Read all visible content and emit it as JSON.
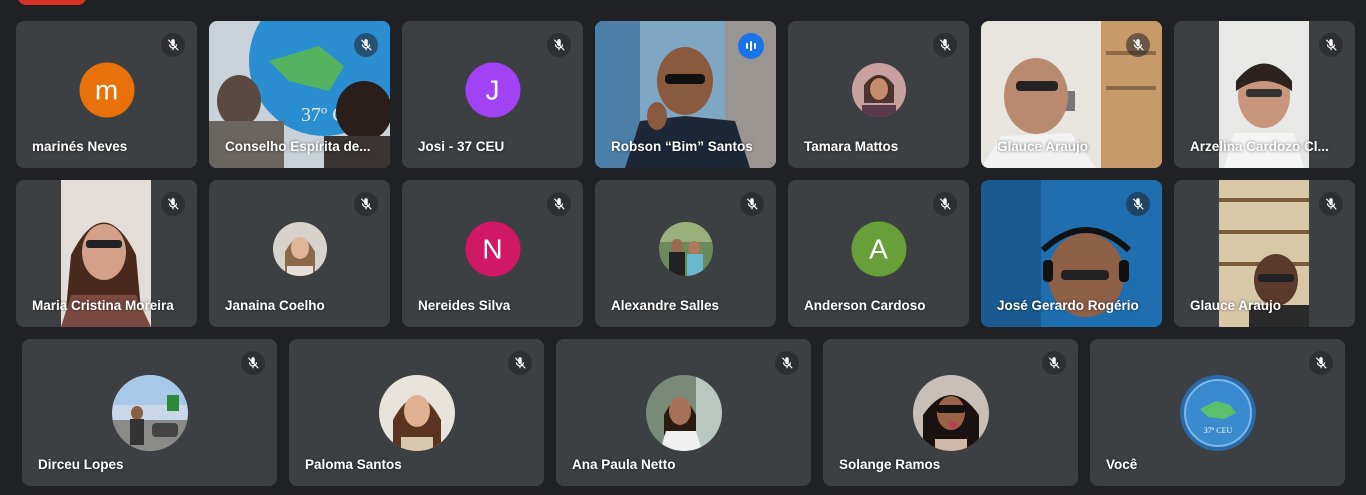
{
  "participants_row1": [
    {
      "name": "marinés Neves",
      "type": "letter",
      "letter": "m",
      "color": "#e8710a"
    },
    {
      "name": "Conselho Espírita de...",
      "type": "video"
    },
    {
      "name": "Josi - 37 CEU",
      "type": "letter",
      "letter": "J",
      "color": "#a142f4"
    },
    {
      "name": "Robson “Bim” Santos",
      "type": "video",
      "speaking": true
    },
    {
      "name": "Tamara Mattos",
      "type": "photo"
    },
    {
      "name": "Glauce Araujo",
      "type": "video"
    },
    {
      "name": "Arzelina Cardozo Cl...",
      "type": "video"
    }
  ],
  "participants_row2": [
    {
      "name": "Maria Cristina Moreira",
      "type": "video"
    },
    {
      "name": "Janaina Coelho",
      "type": "photo"
    },
    {
      "name": "Nereides Silva",
      "type": "letter",
      "letter": "N",
      "color": "#d01864"
    },
    {
      "name": "Alexandre Salles",
      "type": "photo"
    },
    {
      "name": "Anderson Cardoso",
      "type": "letter",
      "letter": "A",
      "color": "#689f38"
    },
    {
      "name": "José Gerardo Rogério",
      "type": "video"
    },
    {
      "name": "Glauce Araujo",
      "type": "video"
    }
  ],
  "participants_row3": [
    {
      "name": "Dirceu Lopes",
      "type": "photo"
    },
    {
      "name": "Paloma Santos",
      "type": "photo"
    },
    {
      "name": "Ana Paula Netto",
      "type": "photo"
    },
    {
      "name": "Solange Ramos",
      "type": "photo"
    },
    {
      "name": "Você",
      "type": "logo"
    }
  ],
  "logo_text": "37º CEU",
  "icons": {
    "muted": "mic-off-icon",
    "speaking": "audio-level-icon"
  },
  "colors": {
    "tile_bg": "#3c4043",
    "page_bg": "#202124",
    "active_border": "#8ab4f8",
    "recording": "#d93025"
  }
}
